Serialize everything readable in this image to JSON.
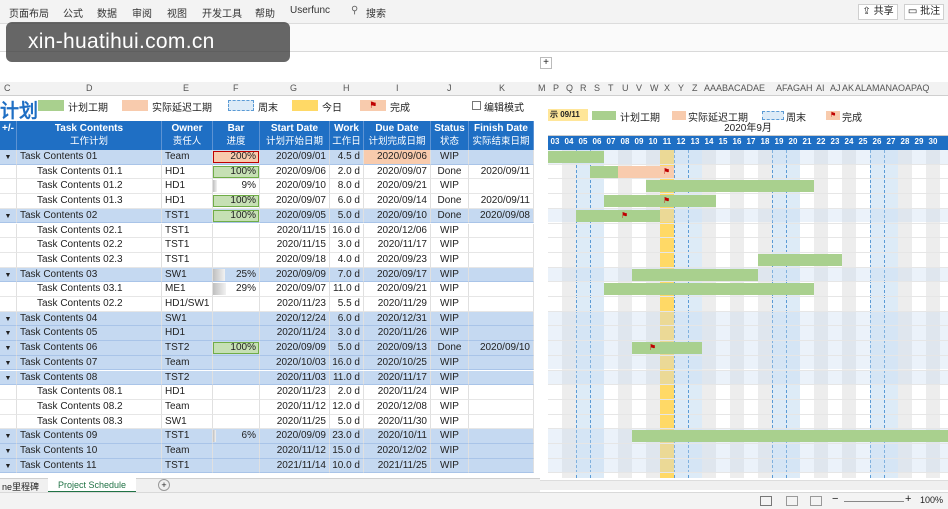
{
  "ribbon": {
    "menus": [
      "页面布局",
      "公式",
      "数据",
      "审阅",
      "视图",
      "开发工具",
      "帮助",
      "Userfunc",
      "搜索"
    ],
    "share_label": "共享",
    "comment_label": "批注"
  },
  "watermark": "xin-huatihui.com.cn",
  "column_letters": [
    "C",
    "D",
    "E",
    "F",
    "G",
    "H",
    "I",
    "J",
    "K",
    "M",
    "P",
    "Q",
    "R",
    "S",
    "T",
    "U",
    "V",
    "W",
    "X",
    "Y",
    "Z",
    "AAABACADAE",
    "AFAGAH",
    "AI",
    "AJ",
    "AK",
    "ALAMANAOAPAQ"
  ],
  "sheet_title_fragment": "计划",
  "legend": {
    "planned": "计划工期",
    "actual_delay": "实际延迟工期",
    "weekend": "周末",
    "today": "今日",
    "done": "完成",
    "edit_mode": "编辑模式"
  },
  "gantt_legend": {
    "display_label": "示 09/11",
    "planned": "计划工期",
    "actual_delay": "实际延迟工期",
    "weekend": "周末",
    "done": "完成"
  },
  "gantt_month": "2020年9月",
  "gantt_days": [
    "03",
    "04",
    "05",
    "06",
    "07",
    "08",
    "09",
    "10",
    "11",
    "12",
    "13",
    "14",
    "15",
    "16",
    "17",
    "18",
    "19",
    "20",
    "21",
    "22",
    "23",
    "24",
    "25",
    "26",
    "27",
    "28",
    "29",
    "30"
  ],
  "headers": [
    {
      "en": "+/-",
      "cn": ""
    },
    {
      "en": "Task Contents",
      "cn": "工作计划"
    },
    {
      "en": "Owner",
      "cn": "责任人"
    },
    {
      "en": "Bar",
      "cn": "进度"
    },
    {
      "en": "Start Date",
      "cn": "计划开始日期"
    },
    {
      "en": "Work",
      "cn": "工作日"
    },
    {
      "en": "Due Date",
      "cn": "计划完成日期"
    },
    {
      "en": "Status",
      "cn": "状态"
    },
    {
      "en": "Finish Date",
      "cn": "实际结束日期"
    }
  ],
  "rows": [
    {
      "level": 1,
      "task": "Task Contents 01",
      "owner": "Team",
      "bar": "200%",
      "bar_pct": 1.0,
      "start": "2020/09/01",
      "work": "4.5 d",
      "due": "2020/09/06",
      "status": "WIP",
      "finish": ""
    },
    {
      "level": 2,
      "task": "Task Contents 01.1",
      "owner": "HD1",
      "bar": "100%",
      "bar_pct": 1.0,
      "start": "2020/09/06",
      "work": "2.0 d",
      "due": "2020/09/07",
      "status": "Done",
      "finish": "2020/09/11"
    },
    {
      "level": 2,
      "task": "Task Contents 01.2",
      "owner": "HD1",
      "bar": "9%",
      "bar_pct": 0.09,
      "start": "2020/09/10",
      "work": "8.0 d",
      "due": "2020/09/21",
      "status": "WIP",
      "finish": ""
    },
    {
      "level": 2,
      "task": "Task Contents 01.3",
      "owner": "HD1",
      "bar": "100%",
      "bar_pct": 1.0,
      "start": "2020/09/07",
      "work": "6.0 d",
      "due": "2020/09/14",
      "status": "Done",
      "finish": "2020/09/11"
    },
    {
      "level": 1,
      "task": "Task Contents 02",
      "owner": "TST1",
      "bar": "100%",
      "bar_pct": 1.0,
      "start": "2020/09/05",
      "work": "5.0 d",
      "due": "2020/09/10",
      "status": "Done",
      "finish": "2020/09/08"
    },
    {
      "level": 2,
      "task": "Task Contents 02.1",
      "owner": "TST1",
      "bar": "",
      "bar_pct": 0,
      "start": "2020/11/15",
      "work": "16.0 d",
      "due": "2020/12/06",
      "status": "WIP",
      "finish": ""
    },
    {
      "level": 2,
      "task": "Task Contents 02.2",
      "owner": "TST1",
      "bar": "",
      "bar_pct": 0,
      "start": "2020/11/15",
      "work": "3.0 d",
      "due": "2020/11/17",
      "status": "WIP",
      "finish": ""
    },
    {
      "level": 2,
      "task": "Task Contents 02.3",
      "owner": "TST1",
      "bar": "",
      "bar_pct": 0,
      "start": "2020/09/18",
      "work": "4.0 d",
      "due": "2020/09/23",
      "status": "WIP",
      "finish": ""
    },
    {
      "level": 1,
      "task": "Task Contents 03",
      "owner": "SW1",
      "bar": "25%",
      "bar_pct": 0.25,
      "start": "2020/09/09",
      "work": "7.0 d",
      "due": "2020/09/17",
      "status": "WIP",
      "finish": ""
    },
    {
      "level": 2,
      "task": "Task Contents 03.1",
      "owner": "ME1",
      "bar": "29%",
      "bar_pct": 0.29,
      "start": "2020/09/07",
      "work": "11.0 d",
      "due": "2020/09/21",
      "status": "WIP",
      "finish": ""
    },
    {
      "level": 2,
      "task": "Task Contents 02.2",
      "owner": "HD1/SW1",
      "bar": "",
      "bar_pct": 0,
      "start": "2020/11/23",
      "work": "5.5 d",
      "due": "2020/11/29",
      "status": "WIP",
      "finish": ""
    },
    {
      "level": 1,
      "task": "Task Contents 04",
      "owner": "SW1",
      "bar": "",
      "bar_pct": 0,
      "start": "2020/12/24",
      "work": "6.0 d",
      "due": "2020/12/31",
      "status": "WIP",
      "finish": ""
    },
    {
      "level": 1,
      "task": "Task Contents 05",
      "owner": "HD1",
      "bar": "",
      "bar_pct": 0,
      "start": "2020/11/24",
      "work": "3.0 d",
      "due": "2020/11/26",
      "status": "WIP",
      "finish": ""
    },
    {
      "level": 1,
      "task": "Task Contents 06",
      "owner": "TST2",
      "bar": "100%",
      "bar_pct": 1.0,
      "start": "2020/09/09",
      "work": "5.0 d",
      "due": "2020/09/13",
      "status": "Done",
      "finish": "2020/09/10"
    },
    {
      "level": 1,
      "task": "Task Contents 07",
      "owner": "Team",
      "bar": "",
      "bar_pct": 0,
      "start": "2020/10/03",
      "work": "16.0 d",
      "due": "2020/10/25",
      "status": "WIP",
      "finish": ""
    },
    {
      "level": 1,
      "task": "Task Contents 08",
      "owner": "TST2",
      "bar": "",
      "bar_pct": 0,
      "start": "2020/11/03",
      "work": "11.0 d",
      "due": "2020/11/17",
      "status": "WIP",
      "finish": ""
    },
    {
      "level": 2,
      "task": "Task Contents 08.1",
      "owner": "HD1",
      "bar": "",
      "bar_pct": 0,
      "start": "2020/11/23",
      "work": "2.0 d",
      "due": "2020/11/24",
      "status": "WIP",
      "finish": ""
    },
    {
      "level": 2,
      "task": "Task Contents 08.2",
      "owner": "Team",
      "bar": "",
      "bar_pct": 0,
      "start": "2020/11/12",
      "work": "12.0 d",
      "due": "2020/12/08",
      "status": "WIP",
      "finish": ""
    },
    {
      "level": 2,
      "task": "Task Contents 08.3",
      "owner": "SW1",
      "bar": "",
      "bar_pct": 0,
      "start": "2020/11/25",
      "work": "5.0 d",
      "due": "2020/11/30",
      "status": "WIP",
      "finish": ""
    },
    {
      "level": 1,
      "task": "Task Contents 09",
      "owner": "TST1",
      "bar": "6%",
      "bar_pct": 0.06,
      "start": "2020/09/09",
      "work": "23.0 d",
      "due": "2020/10/11",
      "status": "WIP",
      "finish": ""
    },
    {
      "level": 1,
      "task": "Task Contents 10",
      "owner": "Team",
      "bar": "",
      "bar_pct": 0,
      "start": "2020/11/12",
      "work": "15.0 d",
      "due": "2020/12/02",
      "status": "WIP",
      "finish": ""
    },
    {
      "level": 1,
      "task": "Task Contents 11",
      "owner": "TST1",
      "bar": "",
      "bar_pct": 0,
      "start": "2021/11/14",
      "work": "10.0 d",
      "due": "2021/11/25",
      "status": "WIP",
      "finish": ""
    }
  ],
  "sheet_tabs": {
    "prev_tab": "ne里程碑",
    "active_tab": "Project Schedule",
    "add_icon": "+"
  },
  "status": {
    "zoom": "100%"
  },
  "colors": {
    "header_blue": "#1f6fc4",
    "group_row": "#c5d9f1",
    "planned_bar": "#a9d08e",
    "delay_bar": "#f8cbad",
    "weekend": "#ddebf7",
    "today": "#ffd966",
    "flag": "#c00000"
  }
}
